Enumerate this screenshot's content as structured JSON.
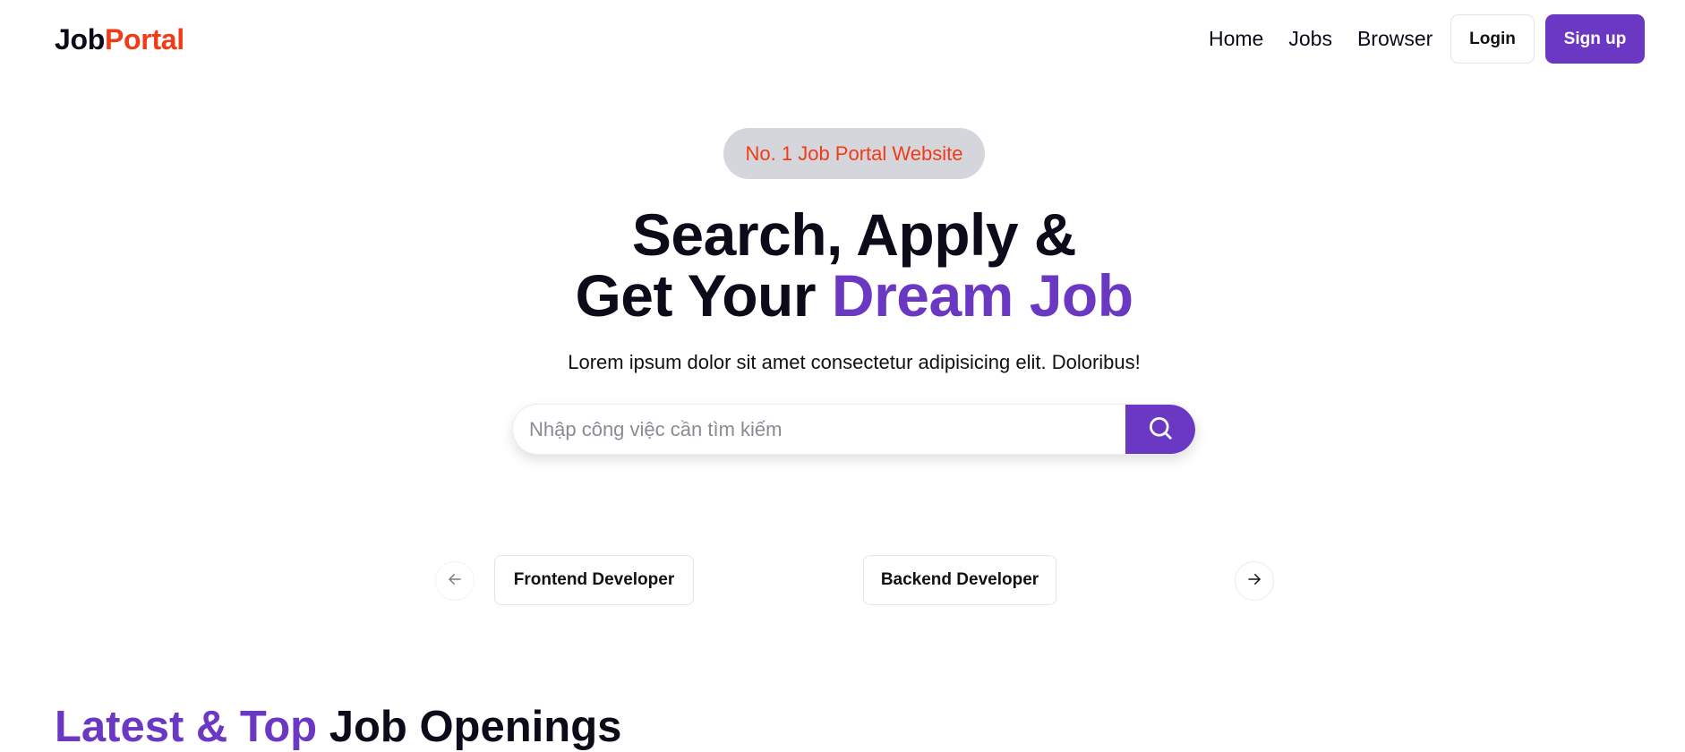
{
  "navbar": {
    "logo_primary": "Job",
    "logo_accent": "Portal",
    "links": [
      "Home",
      "Jobs",
      "Browser"
    ],
    "login_label": "Login",
    "signup_label": "Sign up"
  },
  "hero": {
    "badge": "No. 1 Job Portal Website",
    "title_line1": "Search, Apply &",
    "title_line2_prefix": "Get Your ",
    "title_line2_accent": "Dream Job",
    "subtitle": "Lorem ipsum dolor sit amet consectetur adipisicing elit. Doloribus!",
    "search_placeholder": "Nhập công việc cần tìm kiếm",
    "search_value": ""
  },
  "carousel": {
    "categories": [
      "Frontend Developer",
      "Backend Developer"
    ]
  },
  "latest": {
    "title_accent": "Latest & Top ",
    "title_rest": "Job Openings"
  },
  "colors": {
    "brand_purple": "#6a38c2",
    "logo_red": "#f23a17",
    "badge_bg": "#d5d6db"
  },
  "icons": {
    "search": "magnifier",
    "prev": "arrow-left",
    "next": "arrow-right"
  }
}
